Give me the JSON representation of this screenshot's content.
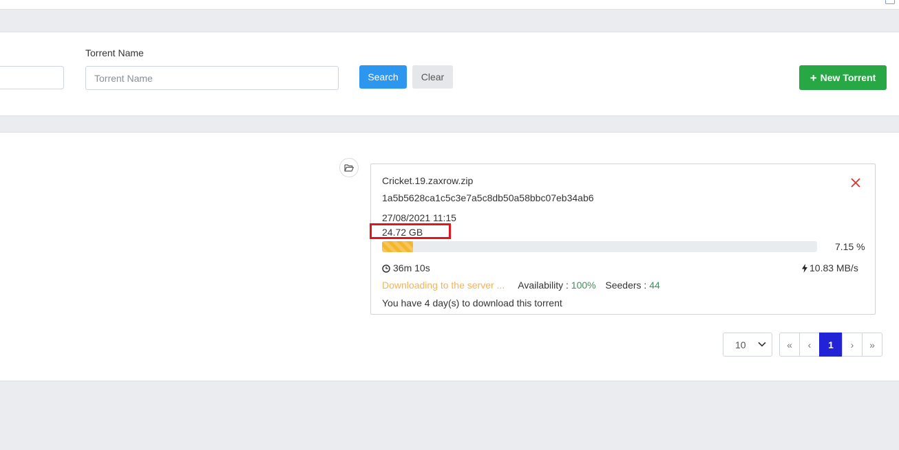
{
  "search": {
    "torrent_name_label": "Torrent Name",
    "torrent_name_placeholder": "Torrent Name",
    "search_label": "Search",
    "clear_label": "Clear",
    "new_torrent_label": "New Torrent"
  },
  "torrent": {
    "name": "Cricket.19.zaxrow.zip",
    "hash": "1a5b5628ca1c5c3e7a5c8db50a58bbc07eb34ab6",
    "date": "27/08/2021 11:15",
    "size": "24.72 GB",
    "progress_text": "7.15 %",
    "progress_fraction": 0.0715,
    "time_remaining": "36m 10s",
    "speed": "10.83 MB/s",
    "status": "Downloading to the server ...",
    "availability_label": "Availability :",
    "availability_value": "100%",
    "seeders_label": "Seeders :",
    "seeders_value": "44",
    "days_notice": "You have 4 day(s) to download this torrent"
  },
  "pagination": {
    "page_size": "10",
    "first": "«",
    "prev": "‹",
    "current": "1",
    "next": "›",
    "last": "»"
  },
  "colors": {
    "search_button": "#2d97f0",
    "new_torrent_button": "#28a745",
    "progress_bar": "#f5b62c",
    "status_text": "#f5b251",
    "active_page": "#2222d6",
    "close_icon": "#d9342b",
    "highlight_box": "#e3141b"
  }
}
